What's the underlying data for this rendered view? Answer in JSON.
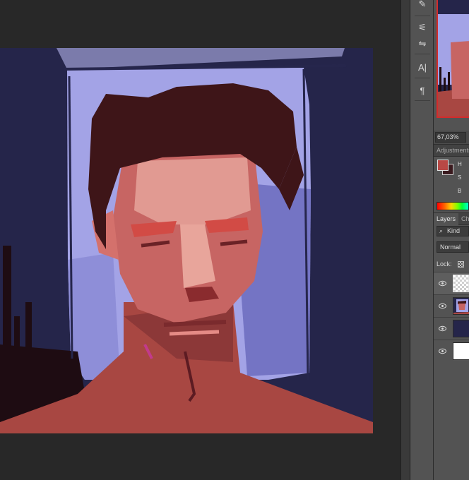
{
  "navigator": {
    "zoom": "67,03%"
  },
  "tools": [
    {
      "name": "mixer-brush-icon",
      "glyph": "✎"
    },
    {
      "name": "brush-settings-icon",
      "glyph": "⚟"
    },
    {
      "name": "character-icon",
      "glyph": "A|"
    },
    {
      "name": "paragraph-icon",
      "glyph": "¶"
    }
  ],
  "adjustments_panel": {
    "tab": "Adjustments"
  },
  "color": {
    "foreground": "#b84845",
    "background": "#3a1a1e",
    "channel_h": "H",
    "channel_s": "S",
    "channel_b": "B"
  },
  "layers_panel": {
    "tab_layers": "Layers",
    "tab_channels": "Ch",
    "filter_kind": "Kind",
    "blend_mode": "Normal",
    "lock_label": "Lock:",
    "layers": [
      {
        "name": "transparent-layer",
        "visible": true,
        "selected": true
      },
      {
        "name": "portrait-layer",
        "visible": true,
        "selected": false
      },
      {
        "name": "dark-fill-layer",
        "visible": true,
        "selected": false
      },
      {
        "name": "white-background-layer",
        "visible": true,
        "selected": false
      }
    ]
  },
  "palette": {
    "navy": "#25254a",
    "lavender": "#a3a3e6",
    "hair": "#3e1518",
    "skin": "#c76563",
    "skin_light": "#e19a92"
  }
}
